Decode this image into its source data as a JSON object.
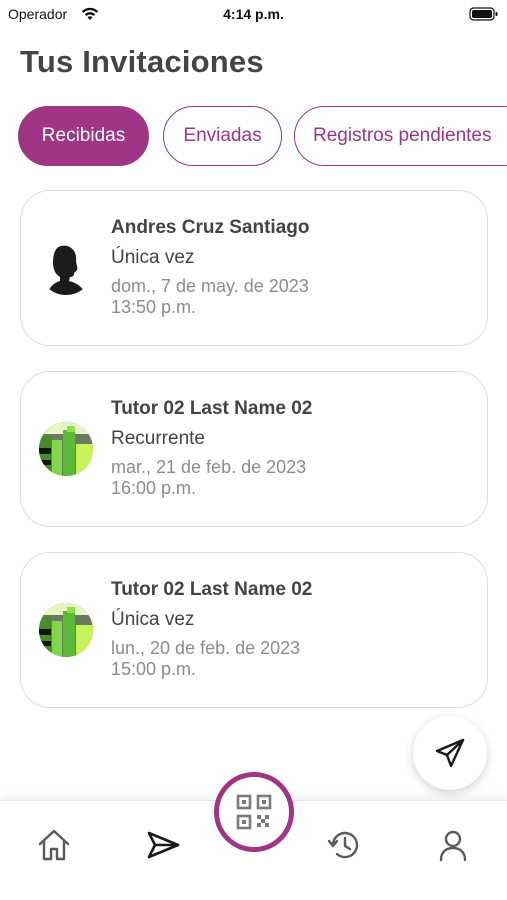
{
  "status_bar": {
    "carrier": "Operador",
    "time": "4:14 p.m."
  },
  "page": {
    "title": "Tus Invitaciones"
  },
  "tabs": [
    {
      "label": "Recibidas",
      "active": true
    },
    {
      "label": "Enviadas",
      "active": false
    },
    {
      "label": "Registros pendientes",
      "active": false
    }
  ],
  "invitations": [
    {
      "name": "Andres Cruz Santiago",
      "type": "Única vez",
      "date": "dom., 7 de may. de 2023",
      "time": "13:50 p.m.",
      "avatar": "silhouette-avatar"
    },
    {
      "name": "Tutor 02 Last Name 02",
      "type": "Recurrente",
      "date": "mar., 21 de feb. de 2023",
      "time": "16:00 p.m.",
      "avatar": "green-bars-avatar"
    },
    {
      "name": "Tutor 02 Last Name 02",
      "type": "Única vez",
      "date": "lun., 20 de feb. de 2023",
      "time": "15:00 p.m.",
      "avatar": "green-bars-avatar"
    }
  ],
  "fab": {
    "icon": "paper-plane-icon"
  },
  "bottom_nav": {
    "items": [
      "home-icon",
      "paper-plane-icon",
      "qr-code-icon",
      "history-icon",
      "user-icon"
    ]
  },
  "colors": {
    "accent": "#a03585",
    "card_border": "#dedede",
    "text": "#444444",
    "muted": "#8c8c8c"
  }
}
